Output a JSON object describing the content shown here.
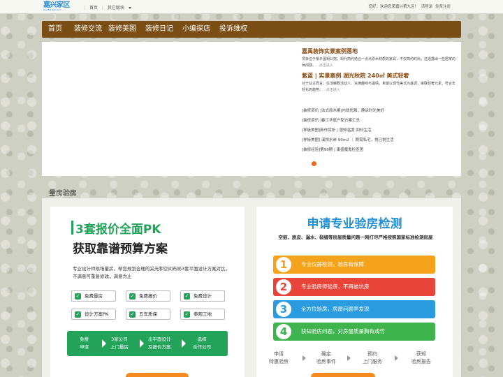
{
  "topbar": {
    "logo_text": "嘉兴家区",
    "logo_sub": "JIAXING JIAJU QU",
    "links": [
      "首页",
      "其它版块"
    ],
    "greeting": "您好，欢迎您来嘉兴第九区！",
    "login": "请登录",
    "register": "免费注册"
  },
  "nav": {
    "items": [
      "首页",
      "装修交流",
      "装修美图",
      "装修日记",
      "小编探店",
      "投诉维权"
    ]
  },
  "banner": {
    "articles": [
      {
        "title": "嘉禹装饰实景案例落地",
        "desc": "项目位于桐乡国玥公馆，现代简约结合一点点原木材质的家具，不仅简约时尚，还透露出一些居家的休闲感。",
        "more": "...点击进入"
      },
      {
        "title": "紫蓝 | 实景案例 湖光秋院 240㎡ 美式轻奢",
        "desc": "对于业主而言，生活精致活动人、充满趣味与温情，希望以现代美式为基调，串联轻奢元素，符合年轻化的趋势。",
        "more": "...点击进入"
      }
    ],
    "list": [
      "[装修资讯 ]法式原木案|内敛优雅，静诉时光美好",
      "[装修资讯 ]春江华庭户型方案汇总",
      "[样板美图]新作赏析 | 感知温度 回归生活",
      "[样板美图] 溪悦水岸 99m2 ｜ 刚需私宅，悦己悦生活",
      "[装修经验]第99期 | 康盛魔鬼检查团"
    ]
  },
  "section": {
    "title": "量房验房"
  },
  "left_card": {
    "headline1": "3套报价全面PK",
    "headline2": "获取靠谱预算方案",
    "desc": "专业设计师现场量房，帮您规划合理的采光和空间布局3套平面设计方案对比，不满意可重复修改，满意为止",
    "checks": [
      "免费量房",
      "免费报价",
      "免费设计",
      "设计方案PK",
      "五年质保",
      "参观工地"
    ],
    "flow": [
      "免费\n申请",
      "3家公司\n上门量房",
      "出平面设计\n及报价方案",
      "选择\n合作公司"
    ]
  },
  "right_card": {
    "headline": "申请专业验房检测",
    "sub": "空鼓、脱皮、漏水、裂缝等房屋质量问题一网打尽严格按照国家标准检测房屋",
    "bars": [
      {
        "num": "1",
        "text": "专业仪器检测，验房有保障",
        "color": "#f5a31b"
      },
      {
        "num": "2",
        "text": "专业验房师验房，不再被坑房",
        "color": "#e8443a"
      },
      {
        "num": "3",
        "text": "全方位验房，房屋问题早发现",
        "color": "#2b9be0"
      },
      {
        "num": "4",
        "text": "获知验房问题，对房屋质量胸有成竹",
        "color": "#3eb34e"
      }
    ],
    "steps": [
      "申请\n特惠验房",
      "确定\n验房事件",
      "预约\n上门服务",
      "获知\n验房报告"
    ]
  }
}
